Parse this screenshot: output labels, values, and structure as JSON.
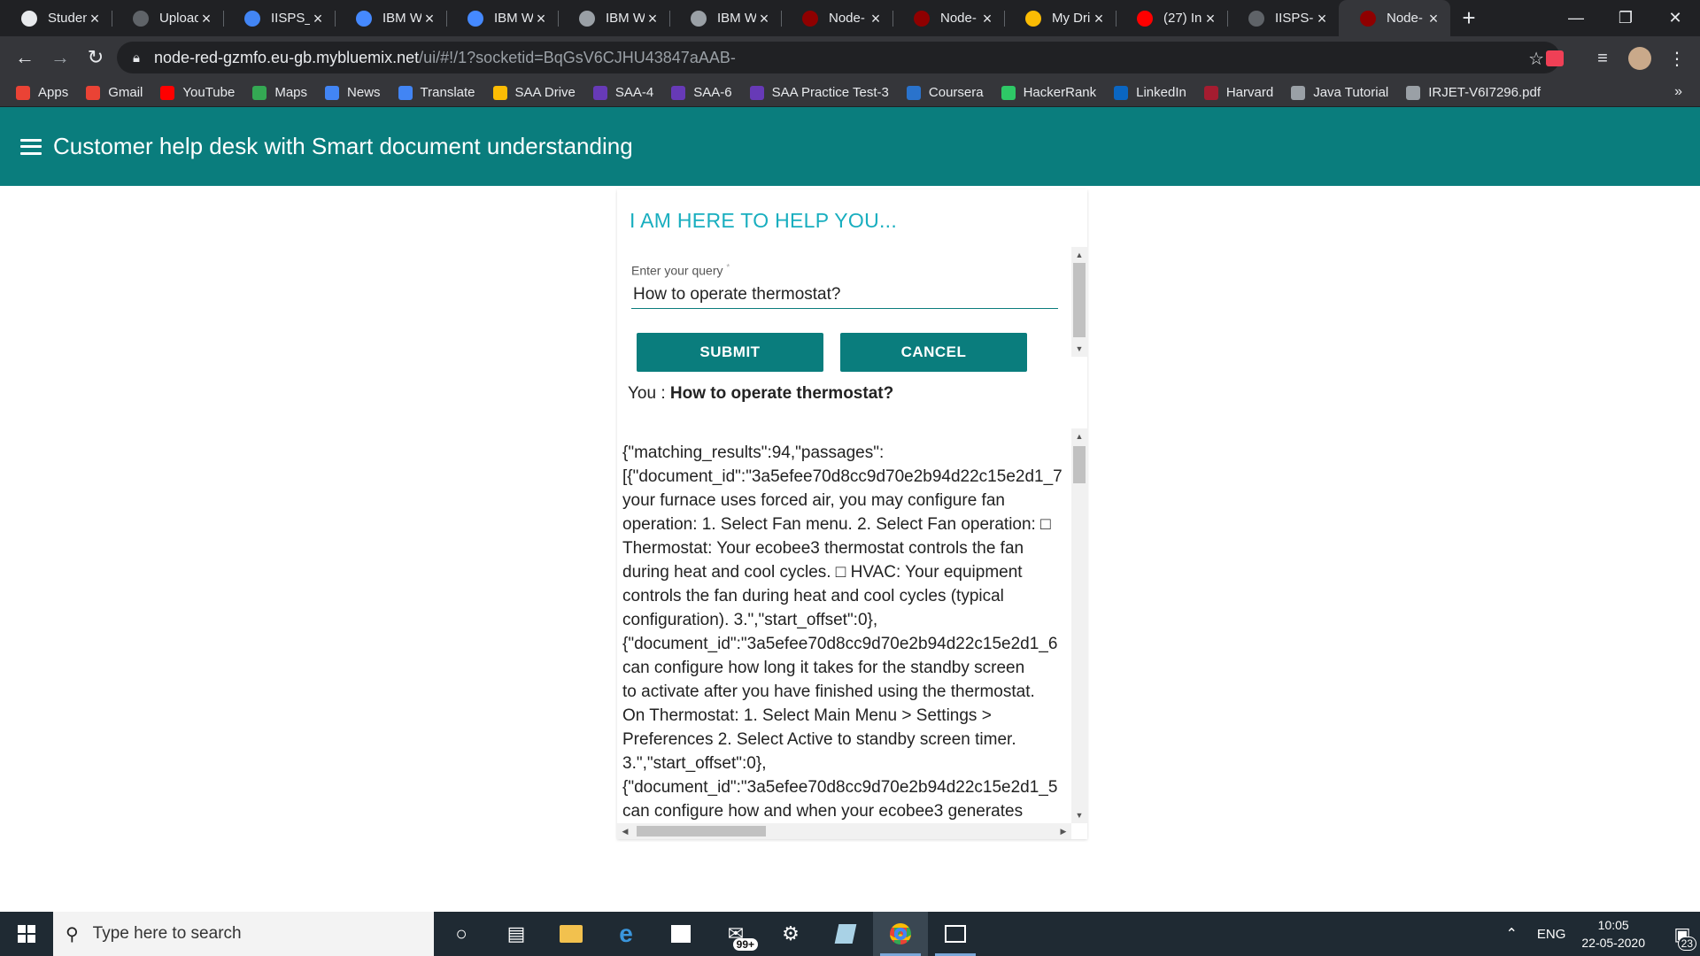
{
  "browser": {
    "tabs": [
      {
        "label": "Studen",
        "icon": "github-icon",
        "color": "#e8eaed"
      },
      {
        "label": "Upload",
        "icon": "github-icon",
        "color": "#5f6368"
      },
      {
        "label": "IISPS_II",
        "icon": "doc-icon",
        "color": "#4285f4"
      },
      {
        "label": "IBM W",
        "icon": "ibm-cloud-icon",
        "color": "#4589ff"
      },
      {
        "label": "IBM W",
        "icon": "ibm-cloud-icon",
        "color": "#4589ff"
      },
      {
        "label": "IBM W",
        "icon": "gear-icon",
        "color": "#9aa0a6"
      },
      {
        "label": "IBM W",
        "icon": "gear-icon",
        "color": "#9aa0a6"
      },
      {
        "label": "Node-",
        "icon": "node-red-icon",
        "color": "#8f0000"
      },
      {
        "label": "Node-",
        "icon": "node-red-icon",
        "color": "#8f0000"
      },
      {
        "label": "My Dri",
        "icon": "drive-icon",
        "color": "#fbbc04"
      },
      {
        "label": "(27) In",
        "icon": "youtube-icon",
        "color": "#ff0000"
      },
      {
        "label": "IISPS-II",
        "icon": "github-icon",
        "color": "#5f6368"
      },
      {
        "label": "Node-",
        "icon": "node-red-icon",
        "color": "#8f0000",
        "active": true
      }
    ],
    "url_host": "node-red-gzmfo.eu-gb.mybluemix.net",
    "url_path": "/ui/#!/1?socketid=BqGsV6CJHU43847aAAB-",
    "bookmarks": [
      {
        "label": "Apps",
        "icon": "apps-grid-icon",
        "color": "#ea4335"
      },
      {
        "label": "Gmail",
        "icon": "gmail-icon",
        "color": "#ea4335"
      },
      {
        "label": "YouTube",
        "icon": "youtube-icon",
        "color": "#ff0000"
      },
      {
        "label": "Maps",
        "icon": "maps-icon",
        "color": "#34a853"
      },
      {
        "label": "News",
        "icon": "news-icon",
        "color": "#4285f4"
      },
      {
        "label": "Translate",
        "icon": "translate-icon",
        "color": "#4285f4"
      },
      {
        "label": "SAA Drive",
        "icon": "drive-icon",
        "color": "#fbbc04"
      },
      {
        "label": "SAA-4",
        "icon": "form-icon",
        "color": "#673ab7"
      },
      {
        "label": "SAA-6",
        "icon": "form-icon",
        "color": "#673ab7"
      },
      {
        "label": "SAA Practice Test-3",
        "icon": "form-icon",
        "color": "#673ab7"
      },
      {
        "label": "Coursera",
        "icon": "coursera-icon",
        "color": "#2a73cc"
      },
      {
        "label": "HackerRank",
        "icon": "hackerrank-icon",
        "color": "#2ec866"
      },
      {
        "label": "LinkedIn",
        "icon": "linkedin-icon",
        "color": "#0a66c2"
      },
      {
        "label": "Harvard",
        "icon": "harvard-icon",
        "color": "#a51c30"
      },
      {
        "label": "Java Tutorial",
        "icon": "java-icon",
        "color": "#9aa0a6"
      },
      {
        "label": "IRJET-V6I7296.pdf",
        "icon": "globe-icon",
        "color": "#9aa0a6"
      }
    ]
  },
  "app": {
    "title": "Customer help desk with Smart document understanding",
    "accent": "#0a7d7d",
    "heading_color": "#18aebf"
  },
  "card": {
    "heading": "I AM HERE TO HELP YOU...",
    "query_label": "Enter your query",
    "query_required_mark": "*",
    "query_value": "How to operate thermostat?",
    "submit_label": "SUBMIT",
    "cancel_label": "CANCEL",
    "you_prefix": "You :",
    "you_query": "How to operate thermostat?",
    "result_text": "{\"matching_results\":94,\"passages\":\n[{\"document_id\":\"3a5efee70d8cc9d70e2b94d22c15e2d1_7\nyour furnace uses forced air, you may configure fan\noperation: 1. Select Fan menu. 2. Select Fan operation: □\nThermostat: Your ecobee3 thermostat controls the fan\nduring heat and cool cycles. □ HVAC: Your equipment\ncontrols the fan during heat and cool cycles (typical\nconfiguration). 3.\",\"start_offset\":0},\n{\"document_id\":\"3a5efee70d8cc9d70e2b94d22c15e2d1_6\ncan configure how long it takes for the standby screen\nto activate after you have finished using the thermostat.\nOn Thermostat: 1. Select Main Menu > Settings >\nPreferences 2. Select Active to standby screen timer.\n3.\",\"start_offset\":0},\n{\"document_id\":\"3a5efee70d8cc9d70e2b94d22c15e2d1_5\ncan configure how and when your ecobee3 generates"
  },
  "taskbar": {
    "search_placeholder": "Type here to search",
    "mail_badge": "99+",
    "lang": "ENG",
    "time": "10:05",
    "date": "22-05-2020",
    "notification_count": "23"
  }
}
